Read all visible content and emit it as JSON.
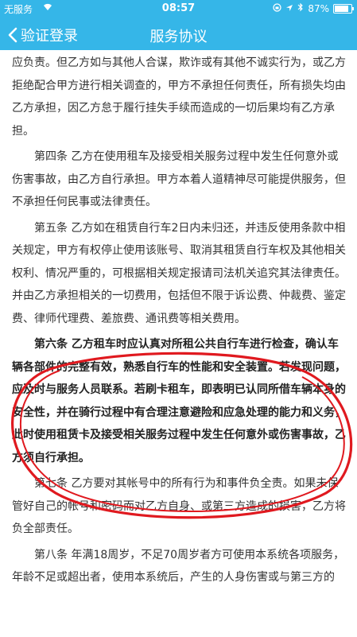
{
  "status_bar": {
    "carrier": "无服务",
    "time": "08:57",
    "battery": "87%",
    "battery_level": 0.87
  },
  "nav": {
    "back_label": "验证登录",
    "title": "服务协议"
  },
  "article": {
    "paragraphs": [
      {
        "text": "应负责。但乙方如与其他人合谋，欺诈或有其他不诚实行为，或乙方拒绝配合甲方进行相关调查的，甲方不承担任何责任，所有损失均由乙方承担，因乙方怠于履行挂失手续而造成的一切后果均有乙方承担。"
      },
      {
        "text": "第四条 乙方在使用租车及接受相关服务过程中发生任何意外或伤害事故，由乙方自行承担。甲方本着人道精神尽可能提供服务，但不承担任何民事或法律责任。"
      },
      {
        "text": "第五条 乙方如在租赁自行车2日内未归还，并违反使用条款中相关规定，甲方有权停止使用该账号、取消其租赁自行车权及其他相关权利、情况严重的，可根据相关规定报请司法机关追究其法律责任。并由乙方承担相关的一切费用，包括但不限于诉讼费、仲裁费、鉴定费、律师代理费、差旅费、通讯费等相关费用。"
      },
      {
        "text": "第六条 乙方租车时应认真对所租公共自行车进行检查，确认车辆各部件的完整有效，熟悉自行车的性能和安全装置。若发现问题，应及时与服务人员联系。若刷卡租车，即表明已认同所借车辆本身的安全性，并在骑行过程中有合理注意避险和应急处理的能力和义务，此时使用租赁卡及接受相关服务过程中发生任何意外或伤害事故，乙方须自行承担。"
      },
      {
        "text": "第七条 乙方要对其帐号中的所有行为和事件负全责。如果未保管好自己的帐号和密码而对乙方自身、或第三方造成的损害，乙方将负全部责任。"
      },
      {
        "text": "第八条 年满18周岁，不足70周岁者方可使用本系统各项服务，年龄不足或超出者，使用本系统后，产生的人身伤害或与第三方的"
      }
    ]
  }
}
